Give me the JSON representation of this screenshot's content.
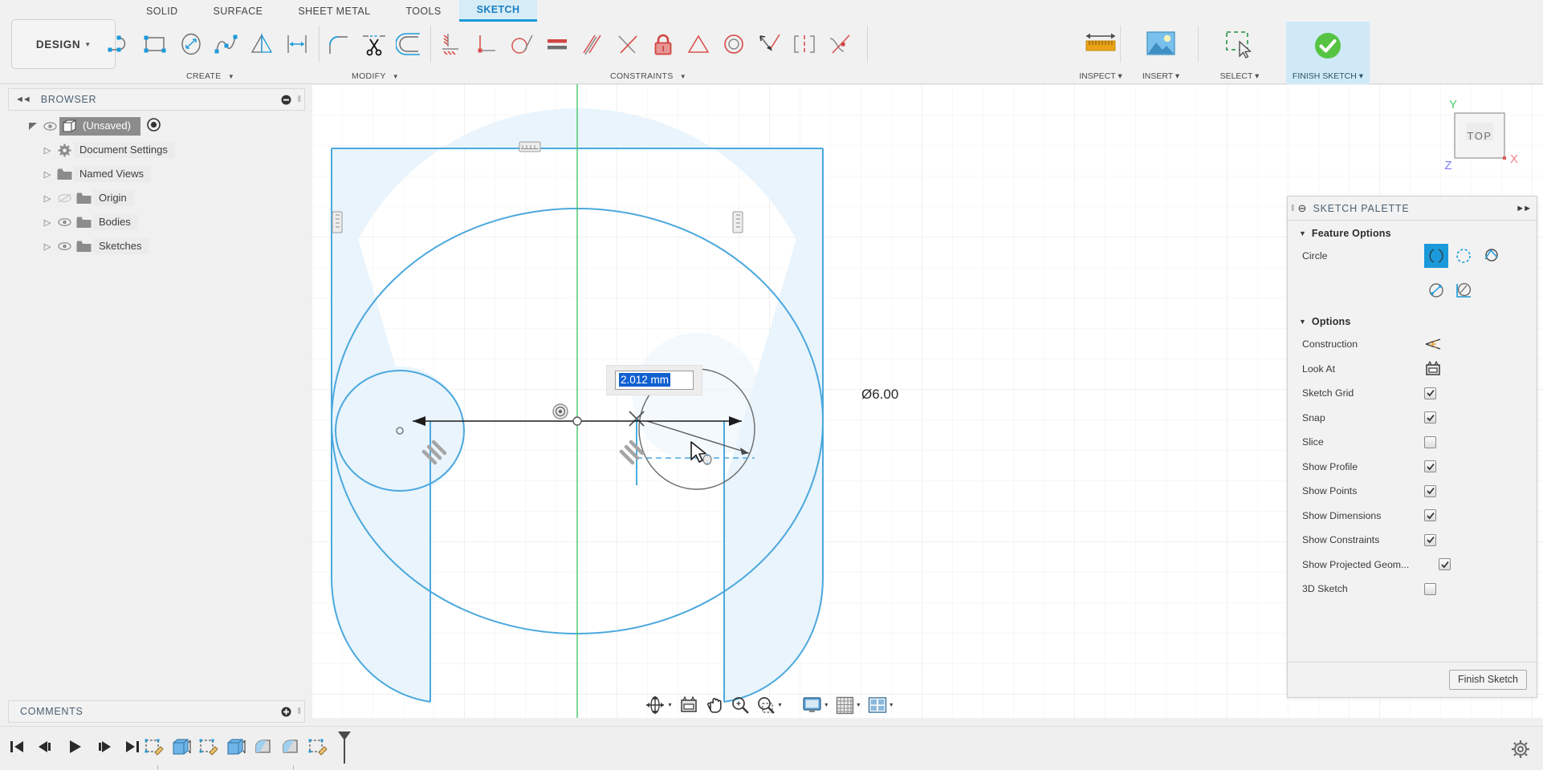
{
  "app": {
    "workspace_label": "DESIGN",
    "workspace_tabs": [
      {
        "label": "SOLID",
        "active": false
      },
      {
        "label": "SURFACE",
        "active": false
      },
      {
        "label": "SHEET METAL",
        "active": false
      },
      {
        "label": "TOOLS",
        "active": false
      },
      {
        "label": "SKETCH",
        "active": true
      }
    ]
  },
  "ribbon": {
    "groups": [
      {
        "title": "CREATE",
        "tools": [
          {
            "name": "line-tool",
            "tip": "Line"
          },
          {
            "name": "rectangle-tool",
            "tip": "Rectangle"
          },
          {
            "name": "circle-tool",
            "tip": "Circle"
          },
          {
            "name": "spline-tool",
            "tip": "Spline"
          },
          {
            "name": "mirror-tool",
            "tip": "Mirror"
          },
          {
            "name": "sketch-dimension-tool",
            "tip": "Sketch Dimension"
          }
        ]
      },
      {
        "title": "MODIFY",
        "tools": [
          {
            "name": "fillet-tool",
            "tip": "Fillet"
          },
          {
            "name": "trim-tool",
            "tip": "Trim"
          },
          {
            "name": "offset-tool",
            "tip": "Offset"
          }
        ]
      },
      {
        "title": "CONSTRAINTS",
        "tools": [
          {
            "name": "horizontal-vertical-constraint",
            "tip": "Horizontal/Vertical"
          },
          {
            "name": "perpendicular-constraint",
            "tip": "Perpendicular"
          },
          {
            "name": "tangent-constraint",
            "tip": "Tangent"
          },
          {
            "name": "equal-constraint",
            "tip": "Equal"
          },
          {
            "name": "parallel-constraint",
            "tip": "Parallel"
          },
          {
            "name": "coincident-constraint",
            "tip": "Coincident"
          },
          {
            "name": "fix-unfix-constraint",
            "tip": "Fix/UnFix"
          },
          {
            "name": "midpoint-constraint",
            "tip": "Midpoint"
          },
          {
            "name": "concentric-constraint",
            "tip": "Concentric"
          },
          {
            "name": "collinear-constraint",
            "tip": "Collinear"
          },
          {
            "name": "symmetry-constraint",
            "tip": "Symmetry"
          },
          {
            "name": "curvature-constraint",
            "tip": "Curvature"
          }
        ]
      }
    ],
    "big_tools": [
      {
        "name": "inspect-menu",
        "label": "INSPECT"
      },
      {
        "name": "insert-menu",
        "label": "INSERT"
      },
      {
        "name": "select-menu",
        "label": "SELECT"
      },
      {
        "name": "finish-sketch-button",
        "label": "FINISH SKETCH"
      }
    ]
  },
  "browser": {
    "title": "BROWSER",
    "root": "(Unsaved)",
    "items": [
      {
        "label": "Document Settings",
        "icon": "gear-icon",
        "has_eye": false
      },
      {
        "label": "Named Views",
        "icon": "folder-icon",
        "has_eye": false
      },
      {
        "label": "Origin",
        "icon": "folder-icon",
        "has_eye": true,
        "eye_off": true
      },
      {
        "label": "Bodies",
        "icon": "folder-icon",
        "has_eye": true,
        "eye_off": false
      },
      {
        "label": "Sketches",
        "icon": "folder-icon",
        "has_eye": true,
        "eye_off": false
      }
    ]
  },
  "comments": {
    "title": "COMMENTS"
  },
  "canvas": {
    "viewcube": {
      "face": "TOP",
      "axis_x": "X",
      "axis_y": "Y",
      "axis_z": "Z"
    },
    "dimension_label": "Ø6.00",
    "dimension_input_value": "2.012 mm",
    "constraint_markers": [
      "horizontal-constraint-top",
      "vertical-constraint-left",
      "vertical-constraint-right",
      "tangent-constraint-left",
      "tangent-constraint-right"
    ]
  },
  "palette": {
    "title": "SKETCH PALETTE",
    "sections": [
      {
        "title": "Feature Options",
        "rows": [
          {
            "label": "Circle",
            "type": "iconset",
            "icons": [
              {
                "name": "center-diameter-circle-icon",
                "selected": true
              },
              {
                "name": "two-point-circle-icon",
                "selected": false
              },
              {
                "name": "three-point-circle-icon",
                "selected": false
              },
              {
                "name": "two-tangent-circle-icon",
                "selected": false
              },
              {
                "name": "three-tangent-circle-icon",
                "selected": false
              }
            ]
          }
        ]
      },
      {
        "title": "Options",
        "rows": [
          {
            "label": "Construction",
            "type": "icon",
            "icon": "construction-icon"
          },
          {
            "label": "Look At",
            "type": "icon",
            "icon": "look-at-icon"
          },
          {
            "label": "Sketch Grid",
            "type": "checkbox",
            "checked": true
          },
          {
            "label": "Snap",
            "type": "checkbox",
            "checked": true
          },
          {
            "label": "Slice",
            "type": "checkbox",
            "checked": false
          },
          {
            "label": "Show Profile",
            "type": "checkbox",
            "checked": true
          },
          {
            "label": "Show Points",
            "type": "checkbox",
            "checked": true
          },
          {
            "label": "Show Dimensions",
            "type": "checkbox",
            "checked": true
          },
          {
            "label": "Show Constraints",
            "type": "checkbox",
            "checked": true
          },
          {
            "label": "Show Projected Geom...",
            "type": "checkbox",
            "checked": true
          },
          {
            "label": "3D Sketch",
            "type": "checkbox",
            "checked": false
          }
        ]
      }
    ],
    "finish_button": "Finish Sketch"
  },
  "navbar": {
    "items": [
      {
        "name": "orbit-tool",
        "caret": true
      },
      {
        "name": "look-at-tool",
        "caret": false
      },
      {
        "name": "pan-tool",
        "caret": false
      },
      {
        "name": "zoom-tool",
        "caret": false
      },
      {
        "name": "zoom-window-tool",
        "caret": true
      },
      {
        "name": "display-settings-tool",
        "caret": true
      },
      {
        "name": "grid-snaps-tool",
        "caret": true
      },
      {
        "name": "viewports-tool",
        "caret": true
      }
    ]
  },
  "timeline": {
    "playback": [
      {
        "name": "jump-to-beginning-button"
      },
      {
        "name": "step-back-button"
      },
      {
        "name": "play-button"
      },
      {
        "name": "step-forward-button"
      },
      {
        "name": "jump-to-end-button"
      }
    ],
    "features": [
      {
        "name": "timeline-sketch-1"
      },
      {
        "name": "timeline-extrude-1"
      },
      {
        "name": "timeline-sketch-2"
      },
      {
        "name": "timeline-extrude-2"
      },
      {
        "name": "timeline-fillet-1"
      },
      {
        "name": "timeline-fillet-2"
      },
      {
        "name": "timeline-sketch-3"
      }
    ],
    "settings_icon": "gear-icon"
  },
  "colors": {
    "accent_blue": "#1a9ada",
    "sketch_blue": "#4ba8dd",
    "profile_fill": "#e9f4fc",
    "tab_active_bg": "#d6ecf7",
    "green_axis": "#44c767",
    "constraint_red": "#d9534f",
    "finish_green": "#5cb85c",
    "panel_bg": "#f2f2f2",
    "selection_blue": "#1060d0"
  }
}
